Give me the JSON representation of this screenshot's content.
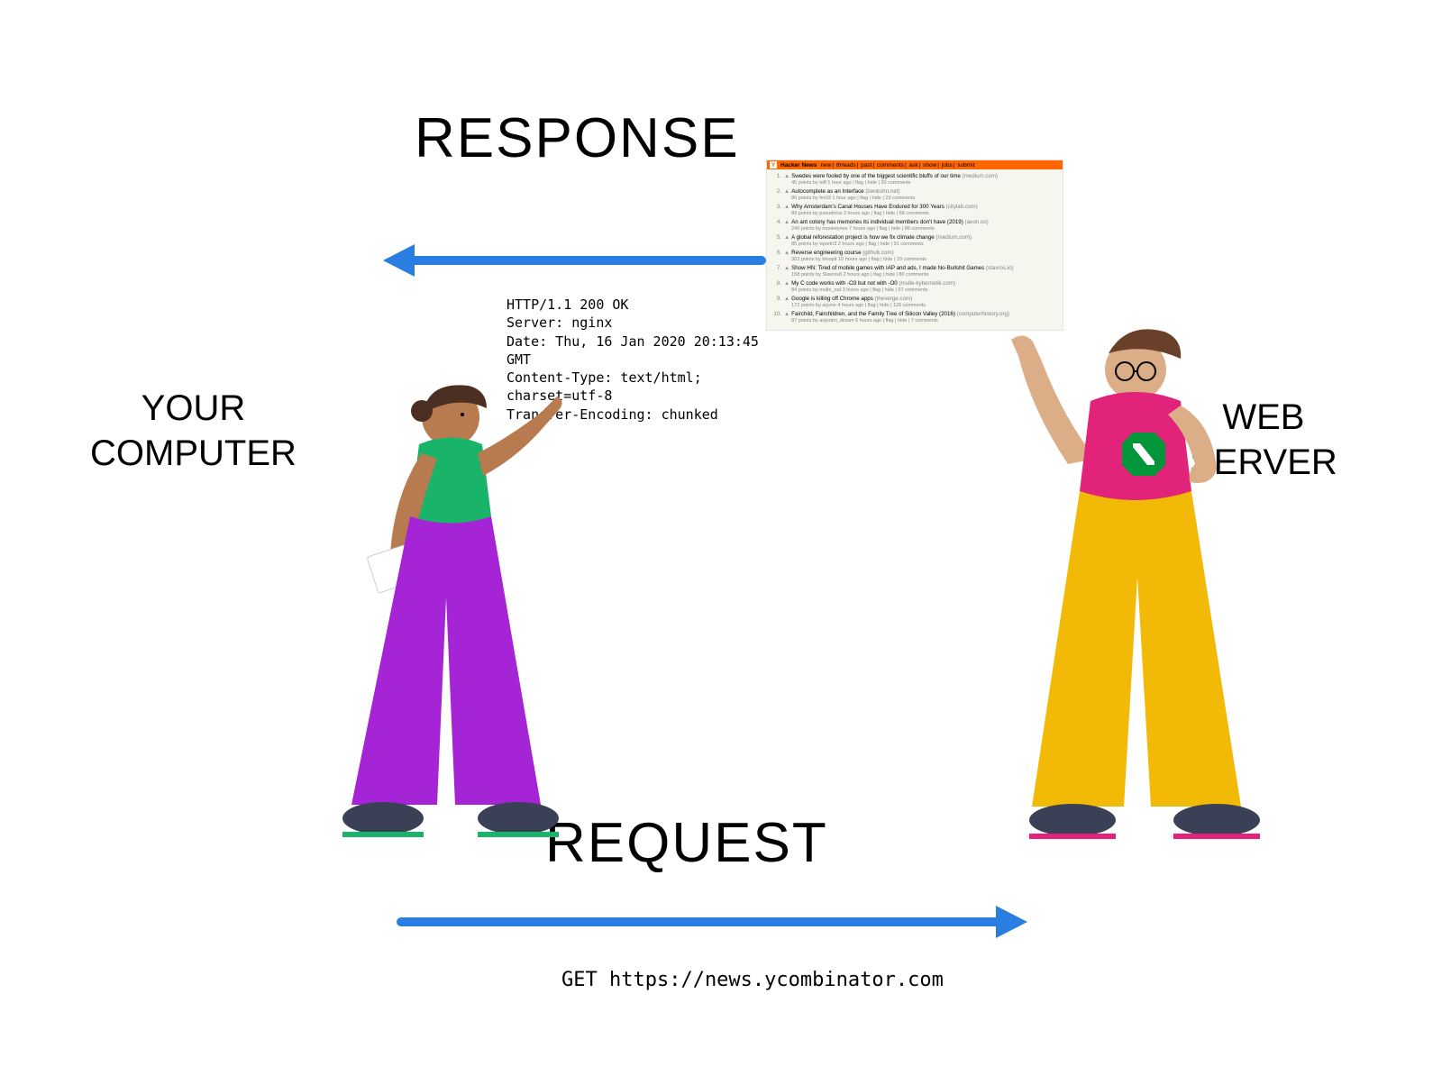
{
  "labels": {
    "response": "RESPONSE",
    "request": "REQUEST",
    "client": "YOUR\nCOMPUTER",
    "server": "WEB\nSERVER"
  },
  "http_response_headers": [
    "HTTP/1.1 200 OK",
    "Server: nginx",
    "Date: Thu, 16 Jan 2020 20:13:45 GMT",
    "Content-Type: text/html; charset=utf-8",
    "Transfer-Encoding: chunked"
  ],
  "http_request_line": "GET  https://news.ycombinator.com",
  "hn": {
    "site_title": "Hacker News",
    "nav": [
      "new",
      "threads",
      "past",
      "comments",
      "ask",
      "show",
      "jobs",
      "submit"
    ],
    "items": [
      {
        "rank": 1,
        "title": "Swedes were fooled by one of the biggest scientific bluffs of our time",
        "domain": "(medium.com)",
        "sub": "45 points by teff 1 hour ago | flag | hide | 30 comments"
      },
      {
        "rank": 2,
        "title": "Autocomplete as an Interface",
        "domain": "(benkuhn.net)",
        "sub": "80 points by fer03 1 hour ago | flag | hide | 23 comments"
      },
      {
        "rank": 3,
        "title": "Why Amsterdam's Canal Houses Have Endured for 300 Years",
        "domain": "(citylab.com)",
        "sub": "89 points by pseudolus 3 hours ago | flag | hide | 68 comments"
      },
      {
        "rank": 4,
        "title": "An ant colony has memories its individual members don't have (2019)",
        "domain": "(aeon.co)",
        "sub": "240 points by monkeynes 7 hours ago | flag | hide | 86 comments"
      },
      {
        "rank": 5,
        "title": "A global reforestation project is how we fix climate change",
        "domain": "(medium.com)",
        "sub": "85 points by wpietri3 2 hours ago | flag | hide | 91 comments"
      },
      {
        "rank": 6,
        "title": "Reverse engineering course",
        "domain": "(github.com)",
        "sub": "363 points by bloopit 10 hours ago | flag | hide | 33 comments"
      },
      {
        "rank": 7,
        "title": "Show HN: Tired of mobile games with IAP and ads, I made No-Bullshit Games",
        "domain": "(stavros.io)",
        "sub": "158 points by Stavros8 2 hours ago | flag | hide | 80 comments"
      },
      {
        "rank": 8,
        "title": "My C code works with -O3 but not with -O0",
        "domain": "(mulle-kybernetik.com)",
        "sub": "84 points by mulle_nat 3 hours ago | flag | hide | 57 comments"
      },
      {
        "rank": 9,
        "title": "Google is killing off Chrome apps",
        "domain": "(theverge.com)",
        "sub": "172 points by arjune 4 hours ago | flag | hide | 126 comments"
      },
      {
        "rank": 10,
        "title": "Fairchild, Fairchildren, and the Family Tree of Silicon Valley (2016)",
        "domain": "(computerhistory.org)",
        "sub": "87 points by anjoden_dream 6 hours ago | flag | hide | 7 comments"
      }
    ]
  },
  "colors": {
    "arrow": "#2a7de1",
    "hn_orange": "#ff6600",
    "client_shirt": "#19b36a",
    "client_pants": "#a524d6",
    "server_shirt": "#e2237a",
    "server_pants": "#f2b907",
    "skin_client": "#b87b4f",
    "skin_server": "#dcae87",
    "hair_client": "#4a2f22",
    "hair_server": "#6a402a",
    "shoe": "#3a4056",
    "nginx_green": "#009639"
  }
}
